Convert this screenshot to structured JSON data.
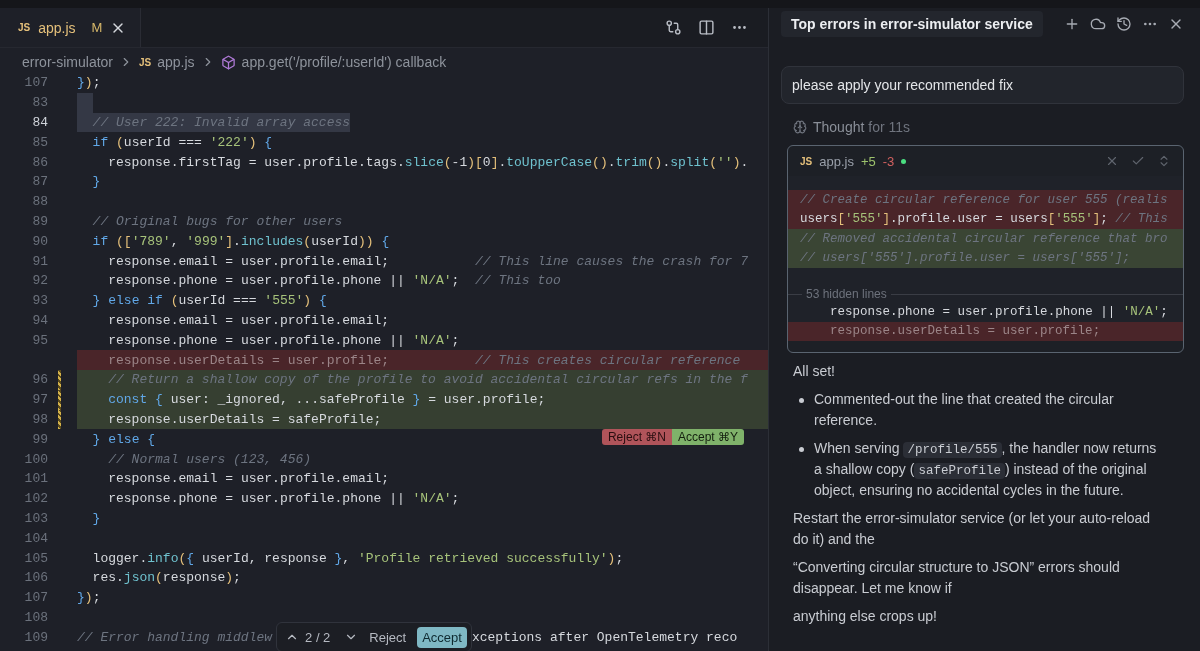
{
  "editor": {
    "tabs": [
      {
        "icon_text": "JS",
        "label": "app.js",
        "badge": "M",
        "selected": true
      }
    ],
    "breadcrumb": [
      {
        "kind": "folder",
        "label": "error-simulator"
      },
      {
        "kind": "file",
        "icon_text": "JS",
        "label": "app.js"
      },
      {
        "kind": "symbol",
        "label": "app.get('/profile/:userId') callback"
      }
    ],
    "lines": [
      {
        "number": "107",
        "kind": "normal",
        "text": "});"
      },
      {
        "number": "83",
        "kind": "selection"
      },
      {
        "number": "84",
        "kind": "cursor",
        "text": "  // User 222: Invalid array access"
      },
      {
        "number": "85",
        "kind": "normal",
        "text": "  if (userId === '222') {"
      },
      {
        "number": "86",
        "kind": "normal",
        "text": "    response.firstTag = user.profile.tags.slice(-1)[0].toUpperCase().trim().split('')."
      },
      {
        "number": "87",
        "kind": "normal",
        "text": "  }"
      },
      {
        "number": "88",
        "kind": "normal"
      },
      {
        "number": "89",
        "kind": "normal",
        "text": "  // Original bugs for other users"
      },
      {
        "number": "90",
        "kind": "normal",
        "text": "  if (['789', '999'].includes(userId)) {"
      },
      {
        "number": "91",
        "kind": "normal",
        "text": "    response.email = user.profile.email;           // This line causes the crash for 7"
      },
      {
        "number": "92",
        "kind": "normal",
        "text": "    response.phone = user.profile.phone || 'N/A';  // This too"
      },
      {
        "number": "93",
        "kind": "normal",
        "text": "  } else if (userId === '555') {"
      },
      {
        "number": "94",
        "kind": "normal",
        "text": "    response.email = user.profile.email;"
      },
      {
        "number": "95",
        "kind": "normal",
        "text": "    response.phone = user.profile.phone || 'N/A';"
      },
      {
        "kind": "removed",
        "text": "    response.userDetails = user.profile;           // This creates circular reference"
      },
      {
        "number": "96",
        "kind": "added",
        "text": "    // Return a shallow copy of the profile to avoid accidental circular refs in the f"
      },
      {
        "number": "97",
        "kind": "added",
        "text": "    const { user: _ignored, ...safeProfile } = user.profile;"
      },
      {
        "number": "98",
        "kind": "added",
        "text": "    response.userDetails = safeProfile;"
      },
      {
        "number": "99",
        "kind": "normal",
        "text": "  } else {",
        "actions": [
          {
            "kind": "reject",
            "label": "Reject ⌘N"
          },
          {
            "kind": "accept",
            "label": "Accept ⌘Y"
          }
        ]
      },
      {
        "number": "100",
        "kind": "normal",
        "text": "    // Normal users (123, 456)"
      },
      {
        "number": "101",
        "kind": "normal",
        "text": "    response.email = user.profile.email;"
      },
      {
        "number": "102",
        "kind": "normal",
        "text": "    response.phone = user.profile.phone || 'N/A';"
      },
      {
        "number": "103",
        "kind": "normal",
        "text": "  }"
      },
      {
        "number": "104",
        "kind": "normal"
      },
      {
        "number": "105",
        "kind": "normal",
        "text": "  logger.info({ userId, response }, 'Profile retrieved successfully');"
      },
      {
        "number": "106",
        "kind": "normal",
        "text": "  res.json(response);"
      },
      {
        "number": "107",
        "kind": "normal",
        "text": "});"
      },
      {
        "number": "108",
        "kind": "normal"
      },
      {
        "number": "109",
        "kind": "normal",
        "text": "// Error handling middlew",
        "text_after": "xceptions after OpenTelemetry reco"
      }
    ],
    "review_bar": {
      "counter": "2 / 2",
      "reject": "Reject",
      "accept": "Accept"
    }
  },
  "chat": {
    "title": "Top errors in error-simulator service",
    "user_message": "please apply your recommended fix",
    "thought": {
      "label": "Thought",
      "duration": "for 11s"
    },
    "diff_card": {
      "icon_text": "JS",
      "file": "app.js",
      "added": "+5",
      "removed": "-3",
      "lines": [
        {
          "kind": "removed",
          "text": "// Create circular reference for user 555 (realis"
        },
        {
          "kind": "removed",
          "text": "users['555'].profile.user = users['555']; // This"
        },
        {
          "kind": "added",
          "text": "// Removed accidental circular reference that bro"
        },
        {
          "kind": "added",
          "text": "// users['555'].profile.user = users['555'];"
        },
        {
          "kind": "separator",
          "text": "53 hidden lines"
        },
        {
          "kind": "normal",
          "text": "    response.phone = user.profile.phone || 'N/A';"
        },
        {
          "kind": "removed",
          "text": "    response.userDetails = user.profile;"
        }
      ]
    },
    "reply": [
      {
        "kind": "paragraph",
        "parts": [
          {
            "kind": "text",
            "text": "All set!"
          }
        ]
      },
      {
        "kind": "bullet",
        "parts": [
          {
            "kind": "text",
            "text": "Commented-out the line that created the circular reference."
          }
        ]
      },
      {
        "kind": "bullet",
        "parts": [
          {
            "kind": "text",
            "text": "When serving "
          },
          {
            "kind": "code",
            "text": "/profile/555"
          },
          {
            "kind": "text",
            "text": ", the handler now returns a shallow copy ("
          },
          {
            "kind": "code",
            "text": "safeProfile"
          },
          {
            "kind": "text",
            "text": ") instead of the original object, ensuring no accidental cycles in the future."
          }
        ]
      },
      {
        "kind": "paragraph",
        "parts": [
          {
            "kind": "text",
            "text": "Restart the error-simulator service (or let your auto-reload do it) and the"
          }
        ]
      },
      {
        "kind": "paragraph",
        "parts": [
          {
            "kind": "text",
            "text": "“Converting circular structure to JSON” errors should disappear. Let me know if"
          }
        ]
      },
      {
        "kind": "paragraph",
        "parts": [
          {
            "kind": "text",
            "text": "anything else crops up!"
          }
        ]
      }
    ]
  }
}
